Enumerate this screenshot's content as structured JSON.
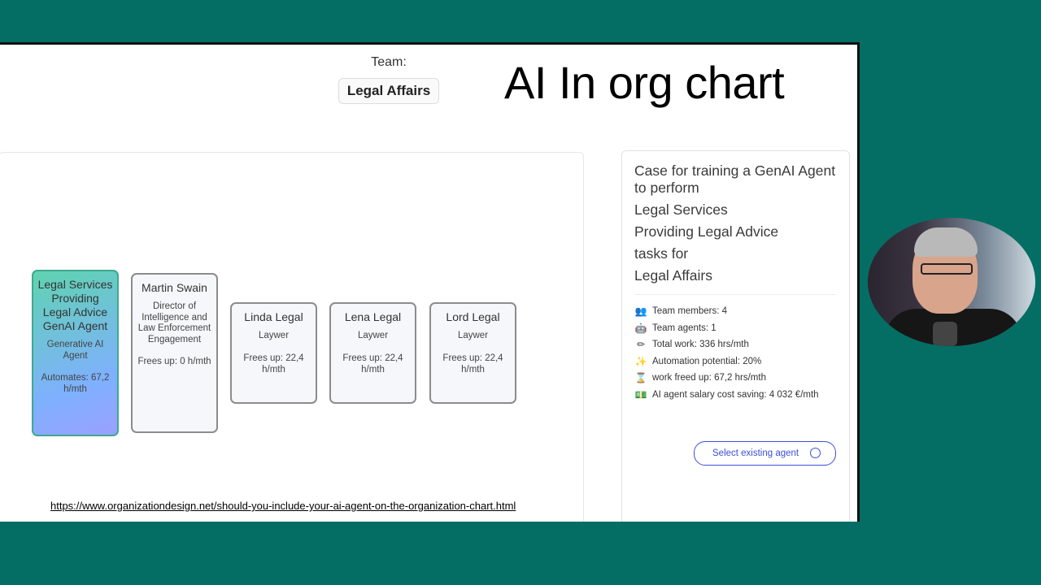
{
  "slide": {
    "title": "AI In org chart",
    "team_label": "Team:",
    "team_name": "Legal Affairs",
    "source_link": "https://www.organizationdesign.net/should-you-include-your-ai-agent-on-the-organization-chart.html"
  },
  "org_cards": [
    {
      "name": "Legal Services Providing Legal Advice GenAI Agent",
      "role": "Generative AI Agent",
      "stat": "Automates: 67,2 h/mth",
      "type": "agent"
    },
    {
      "name": "Martin Swain",
      "role": "Director of Intelligence and Law Enforcement Engagement",
      "stat": "Frees up: 0 h/mth",
      "type": "human"
    },
    {
      "name": "Linda Legal",
      "role": "Laywer",
      "stat": "Frees up: 22,4 h/mth",
      "type": "human"
    },
    {
      "name": "Lena Legal",
      "role": "Laywer",
      "stat": "Frees up: 22,4 h/mth",
      "type": "human"
    },
    {
      "name": "Lord Legal",
      "role": "Laywer",
      "stat": "Frees up: 22,4 h/mth",
      "type": "human"
    }
  ],
  "side_panel": {
    "case_lines": [
      "Case for training a GenAI Agent to perform",
      "Legal Services",
      "Providing Legal Advice",
      "tasks for",
      "Legal Affairs"
    ],
    "metrics": [
      {
        "icon": "team-members-icon",
        "text": "Team members: 4"
      },
      {
        "icon": "robot-icon",
        "text": "Team agents: 1"
      },
      {
        "icon": "pencil-icon",
        "text": "Total work: 336 hrs/mth"
      },
      {
        "icon": "sparkle-icon",
        "text": "Automation potential: 20%"
      },
      {
        "icon": "hourglass-icon",
        "text": "work freed up: 67,2 hrs/mth"
      },
      {
        "icon": "money-icon",
        "text": "AI agent salary cost saving: 4 032 €/mth"
      }
    ],
    "select_button": "Select existing agent"
  },
  "colors": {
    "background": "#046e64",
    "accent": "#3b4fd8",
    "agent_gradient_start": "#5fd3b0",
    "agent_gradient_end": "#9aa0ff"
  }
}
